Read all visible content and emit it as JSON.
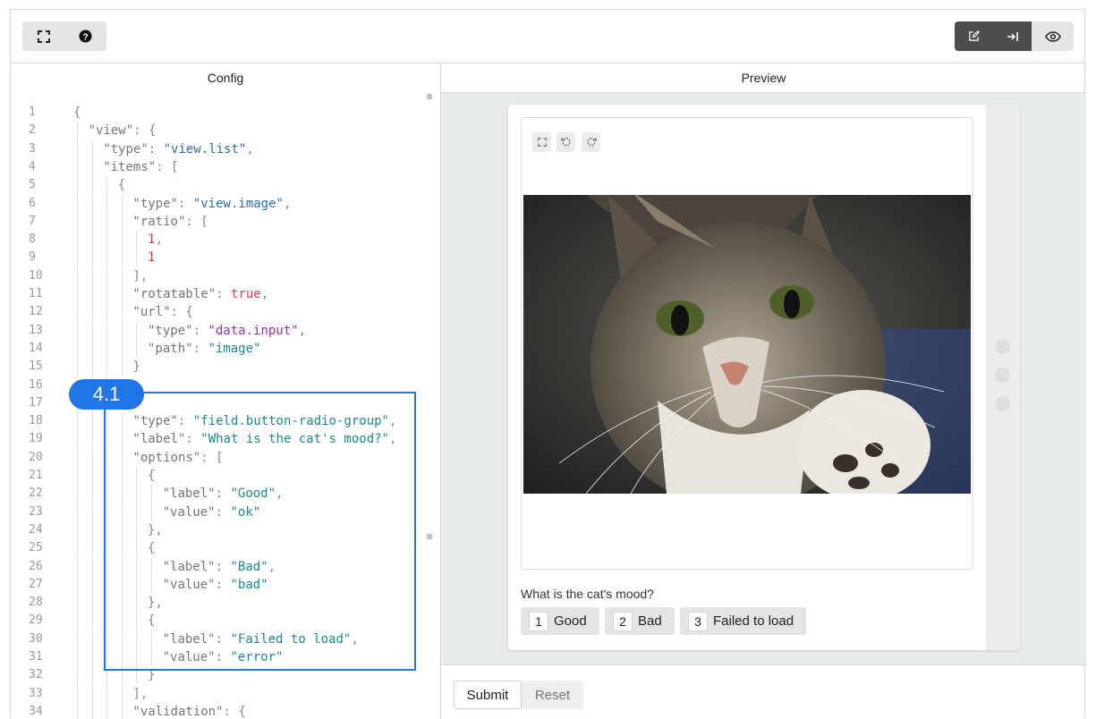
{
  "toolbar": {
    "left_icons": [
      "fullscreen-icon",
      "help-icon"
    ],
    "right_icons": [
      "edit-icon",
      "collapse-right-icon",
      "eye-icon"
    ]
  },
  "config": {
    "title": "Config",
    "lines": [
      {
        "n": "1",
        "indent": 0,
        "tokens": [
          {
            "t": "{",
            "c": "p"
          }
        ]
      },
      {
        "n": "2",
        "indent": 1,
        "tokens": [
          {
            "t": "\"view\"",
            "c": "k"
          },
          {
            "t": ": {",
            "c": "p"
          }
        ]
      },
      {
        "n": "3",
        "indent": 2,
        "tokens": [
          {
            "t": "\"type\"",
            "c": "k"
          },
          {
            "t": ": ",
            "c": "p"
          },
          {
            "t": "\"view.list\"",
            "c": "s"
          },
          {
            "t": ",",
            "c": "p"
          }
        ]
      },
      {
        "n": "4",
        "indent": 2,
        "tokens": [
          {
            "t": "\"items\"",
            "c": "k"
          },
          {
            "t": ": [",
            "c": "p"
          }
        ]
      },
      {
        "n": "5",
        "indent": 3,
        "tokens": [
          {
            "t": "{",
            "c": "p"
          }
        ]
      },
      {
        "n": "6",
        "indent": 4,
        "tokens": [
          {
            "t": "\"type\"",
            "c": "k"
          },
          {
            "t": ": ",
            "c": "p"
          },
          {
            "t": "\"view.image\"",
            "c": "s"
          },
          {
            "t": ",",
            "c": "p"
          }
        ]
      },
      {
        "n": "7",
        "indent": 4,
        "tokens": [
          {
            "t": "\"ratio\"",
            "c": "k"
          },
          {
            "t": ": [",
            "c": "p"
          }
        ]
      },
      {
        "n": "8",
        "indent": 5,
        "tokens": [
          {
            "t": "1",
            "c": "n"
          },
          {
            "t": ",",
            "c": "p"
          }
        ]
      },
      {
        "n": "9",
        "indent": 5,
        "tokens": [
          {
            "t": "1",
            "c": "n"
          }
        ]
      },
      {
        "n": "10",
        "indent": 4,
        "tokens": [
          {
            "t": "],",
            "c": "p"
          }
        ]
      },
      {
        "n": "11",
        "indent": 4,
        "tokens": [
          {
            "t": "\"rotatable\"",
            "c": "k"
          },
          {
            "t": ": ",
            "c": "p"
          },
          {
            "t": "true",
            "c": "n"
          },
          {
            "t": ",",
            "c": "p"
          }
        ]
      },
      {
        "n": "12",
        "indent": 4,
        "tokens": [
          {
            "t": "\"url\"",
            "c": "k"
          },
          {
            "t": ": {",
            "c": "p"
          }
        ]
      },
      {
        "n": "13",
        "indent": 5,
        "tokens": [
          {
            "t": "\"type\"",
            "c": "k"
          },
          {
            "t": ": ",
            "c": "p"
          },
          {
            "t": "\"data.input\"",
            "c": "m"
          },
          {
            "t": ",",
            "c": "p"
          }
        ]
      },
      {
        "n": "14",
        "indent": 5,
        "tokens": [
          {
            "t": "\"path\"",
            "c": "k"
          },
          {
            "t": ": ",
            "c": "p"
          },
          {
            "t": "\"image\"",
            "c": "g"
          }
        ]
      },
      {
        "n": "15",
        "indent": 4,
        "tokens": [
          {
            "t": "}",
            "c": "p"
          }
        ]
      },
      {
        "n": "16",
        "indent": 3,
        "tokens": [
          {
            "t": "},",
            "c": "p"
          }
        ]
      },
      {
        "n": "17",
        "indent": 3,
        "tokens": []
      },
      {
        "n": "18",
        "indent": 4,
        "tokens": [
          {
            "t": "\"type\"",
            "c": "k"
          },
          {
            "t": ": ",
            "c": "p"
          },
          {
            "t": "\"field.button-radio-group\"",
            "c": "g"
          },
          {
            "t": ",",
            "c": "p"
          }
        ]
      },
      {
        "n": "19",
        "indent": 4,
        "tokens": [
          {
            "t": "\"label\"",
            "c": "k"
          },
          {
            "t": ": ",
            "c": "p"
          },
          {
            "t": "\"What is the cat's mood?\"",
            "c": "g"
          },
          {
            "t": ",",
            "c": "p"
          }
        ]
      },
      {
        "n": "20",
        "indent": 4,
        "tokens": [
          {
            "t": "\"options\"",
            "c": "k"
          },
          {
            "t": ": [",
            "c": "p"
          }
        ]
      },
      {
        "n": "21",
        "indent": 5,
        "tokens": [
          {
            "t": "{",
            "c": "p"
          }
        ]
      },
      {
        "n": "22",
        "indent": 6,
        "tokens": [
          {
            "t": "\"label\"",
            "c": "k"
          },
          {
            "t": ": ",
            "c": "p"
          },
          {
            "t": "\"Good\"",
            "c": "g"
          },
          {
            "t": ",",
            "c": "p"
          }
        ]
      },
      {
        "n": "23",
        "indent": 6,
        "tokens": [
          {
            "t": "\"value\"",
            "c": "k"
          },
          {
            "t": ": ",
            "c": "p"
          },
          {
            "t": "\"ok\"",
            "c": "g"
          }
        ]
      },
      {
        "n": "24",
        "indent": 5,
        "tokens": [
          {
            "t": "},",
            "c": "p"
          }
        ]
      },
      {
        "n": "25",
        "indent": 5,
        "tokens": [
          {
            "t": "{",
            "c": "p"
          }
        ]
      },
      {
        "n": "26",
        "indent": 6,
        "tokens": [
          {
            "t": "\"label\"",
            "c": "k"
          },
          {
            "t": ": ",
            "c": "p"
          },
          {
            "t": "\"Bad\"",
            "c": "g"
          },
          {
            "t": ",",
            "c": "p"
          }
        ]
      },
      {
        "n": "27",
        "indent": 6,
        "tokens": [
          {
            "t": "\"value\"",
            "c": "k"
          },
          {
            "t": ": ",
            "c": "p"
          },
          {
            "t": "\"bad\"",
            "c": "g"
          }
        ]
      },
      {
        "n": "28",
        "indent": 5,
        "tokens": [
          {
            "t": "},",
            "c": "p"
          }
        ]
      },
      {
        "n": "29",
        "indent": 5,
        "tokens": [
          {
            "t": "{",
            "c": "p"
          }
        ]
      },
      {
        "n": "30",
        "indent": 6,
        "tokens": [
          {
            "t": "\"label\"",
            "c": "k"
          },
          {
            "t": ": ",
            "c": "p"
          },
          {
            "t": "\"Failed to load\"",
            "c": "g"
          },
          {
            "t": ",",
            "c": "p"
          }
        ]
      },
      {
        "n": "31",
        "indent": 6,
        "tokens": [
          {
            "t": "\"value\"",
            "c": "k"
          },
          {
            "t": ": ",
            "c": "p"
          },
          {
            "t": "\"error\"",
            "c": "g"
          }
        ]
      },
      {
        "n": "32",
        "indent": 5,
        "tokens": [
          {
            "t": "}",
            "c": "p"
          }
        ]
      },
      {
        "n": "33",
        "indent": 4,
        "tokens": [
          {
            "t": "],",
            "c": "p"
          }
        ]
      },
      {
        "n": "34",
        "indent": 4,
        "tokens": [
          {
            "t": "\"validation\"",
            "c": "k"
          },
          {
            "t": ": {",
            "c": "p"
          }
        ]
      }
    ],
    "callout_label": "4.1"
  },
  "preview": {
    "title": "Preview",
    "image_controls": [
      "fullscreen-icon",
      "rotate-left-icon",
      "rotate-right-icon"
    ],
    "question": "What is the cat's mood?",
    "options": [
      {
        "key": "1",
        "label": "Good"
      },
      {
        "key": "2",
        "label": "Bad"
      },
      {
        "key": "3",
        "label": "Failed to load"
      }
    ]
  },
  "actions": {
    "submit_label": "Submit",
    "reset_label": "Reset"
  },
  "colors": {
    "accent": "#1f77e5",
    "key": "#777777",
    "string_blue": "#2b6cb0",
    "string_teal": "#1a8a8a",
    "string_purple": "#9b30b0",
    "number": "#d43f3f"
  }
}
